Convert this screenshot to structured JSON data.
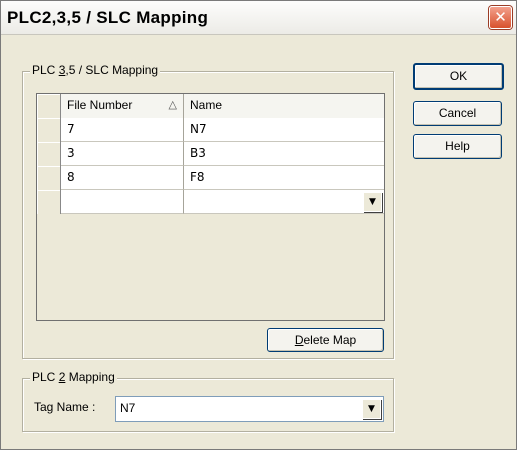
{
  "window": {
    "title": "PLC2,3,5 / SLC Mapping"
  },
  "slc_group": {
    "legend_prefix": "PLC ",
    "legend_accel": "3",
    "legend_suffix": ",5 / SLC Mapping",
    "columns": {
      "file_number": "File Number",
      "name": "Name"
    },
    "rows": [
      {
        "file": "7",
        "name": "N7"
      },
      {
        "file": "3",
        "name": "B3"
      },
      {
        "file": "8",
        "name": "F8"
      },
      {
        "file": "",
        "name": ""
      }
    ],
    "delete_accel": "D",
    "delete_rest": "elete Map"
  },
  "buttons": {
    "ok": "OK",
    "cancel": "Cancel",
    "help": "Help"
  },
  "plc2_group": {
    "legend_prefix": "PLC ",
    "legend_accel": "2",
    "legend_suffix": " Mapping",
    "tag_label": "Tag Name :",
    "tag_value": "N7"
  }
}
